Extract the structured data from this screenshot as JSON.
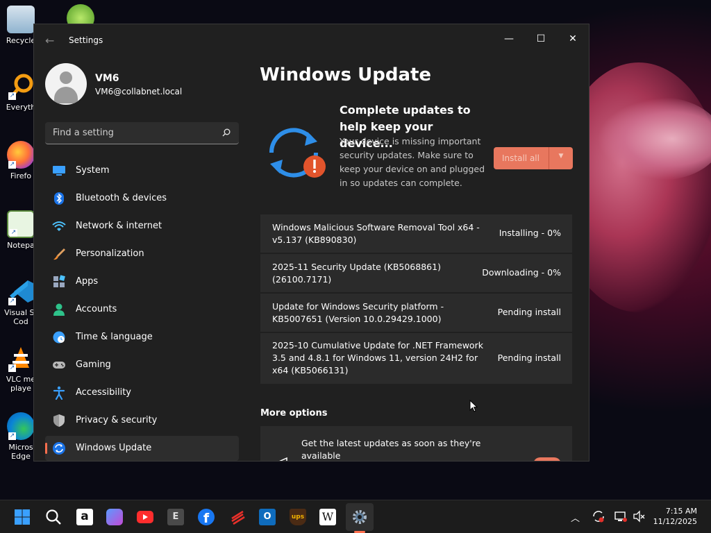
{
  "desktop": {
    "icons": [
      {
        "label": "Recycle",
        "icon": "recycle-bin-icon"
      },
      {
        "label": "Everyth",
        "icon": "everything-search-icon"
      },
      {
        "label": "Firefo",
        "icon": "firefox-icon"
      },
      {
        "label": "Notepa",
        "icon": "notepad-icon"
      },
      {
        "label": "Visual St Cod",
        "icon": "vscode-icon"
      },
      {
        "label": "VLC me playe",
        "icon": "vlc-icon"
      },
      {
        "label": "Micros Edge",
        "icon": "edge-icon"
      }
    ]
  },
  "window": {
    "title": "Settings",
    "controls": {
      "minimize": "—",
      "maximize": "☐",
      "close": "✕"
    }
  },
  "profile": {
    "name": "VM6",
    "email": "VM6@collabnet.local"
  },
  "search": {
    "placeholder": "Find a setting"
  },
  "nav": {
    "items": [
      {
        "label": "System",
        "icon": "system-icon"
      },
      {
        "label": "Bluetooth & devices",
        "icon": "bluetooth-icon"
      },
      {
        "label": "Network & internet",
        "icon": "wifi-icon"
      },
      {
        "label": "Personalization",
        "icon": "brush-icon"
      },
      {
        "label": "Apps",
        "icon": "apps-icon"
      },
      {
        "label": "Accounts",
        "icon": "accounts-icon"
      },
      {
        "label": "Time & language",
        "icon": "globe-clock-icon"
      },
      {
        "label": "Gaming",
        "icon": "gamepad-icon"
      },
      {
        "label": "Accessibility",
        "icon": "accessibility-icon"
      },
      {
        "label": "Privacy & security",
        "icon": "shield-icon"
      },
      {
        "label": "Windows Update",
        "icon": "windows-update-icon"
      }
    ],
    "active_index": 10
  },
  "main": {
    "page_title": "Windows Update",
    "hero": {
      "title": "Complete updates to help keep your device...",
      "description": "Your device is missing important security updates. Make sure to keep your device on and plugged in so updates can complete.",
      "install_button": "Install all"
    },
    "updates": [
      {
        "name": "Windows Malicious Software Removal Tool x64 - v5.137 (KB890830)",
        "status": "Installing - 0%"
      },
      {
        "name": "2025-11 Security Update (KB5068861) (26100.7171)",
        "status": "Downloading - 0%"
      },
      {
        "name": "Update for Windows Security platform - KB5007651 (Version 10.0.29429.1000)",
        "status": "Pending install"
      },
      {
        "name": "2025-10 Cumulative Update for .NET Framework 3.5 and 4.8.1 for Windows 11, version 24H2 for x64 (KB5066131)",
        "status": "Pending install"
      }
    ],
    "more_options": {
      "heading": "More options",
      "get_latest": "Get the latest updates as soon as they're available"
    }
  },
  "taskbar": {
    "apps": [
      "start-icon",
      "search-icon",
      "amazon-icon",
      "copilot-icon",
      "youtube-icon",
      "epic-icon",
      "facebook-icon",
      "app-icon",
      "outlook-icon",
      "ups-icon",
      "wikipedia-icon",
      "settings-icon"
    ],
    "clock": {
      "time": "7:15 AM",
      "date": "11/12/2025"
    }
  },
  "colors": {
    "accent": "#e8775e",
    "window_bg": "#202020",
    "card_bg": "#2b2b2b",
    "taskbar_bg": "#1c1c1c"
  }
}
